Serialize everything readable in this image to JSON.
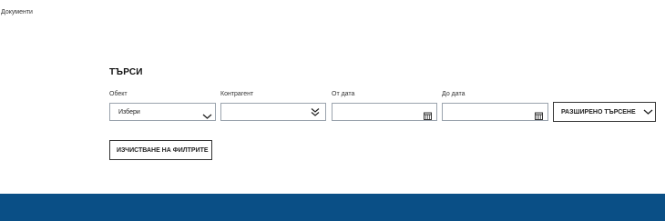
{
  "page": {
    "breadcrumb": "Документи"
  },
  "search": {
    "title": "ТЪРСИ",
    "object": {
      "label": "Обект",
      "value": "Избери"
    },
    "counterparty": {
      "label": "Контрагент",
      "value": ""
    },
    "date_from": {
      "label": "От дата",
      "value": ""
    },
    "date_to": {
      "label": "До дата",
      "value": ""
    },
    "advanced_label": "РАЗШИРЕНО ТЪРСЕНЕ",
    "clear_label": "ИЗЧИСТВАНЕ НА ФИЛТРИТЕ"
  },
  "colors": {
    "footer": "#0a4f86",
    "border": "#9aa3ad"
  },
  "icons": {
    "object": "chevron-down-icon",
    "counterparty": "double-chevron-down-icon",
    "date_from": "calendar-icon",
    "date_to": "calendar-icon",
    "advanced": "chevron-down-icon"
  }
}
